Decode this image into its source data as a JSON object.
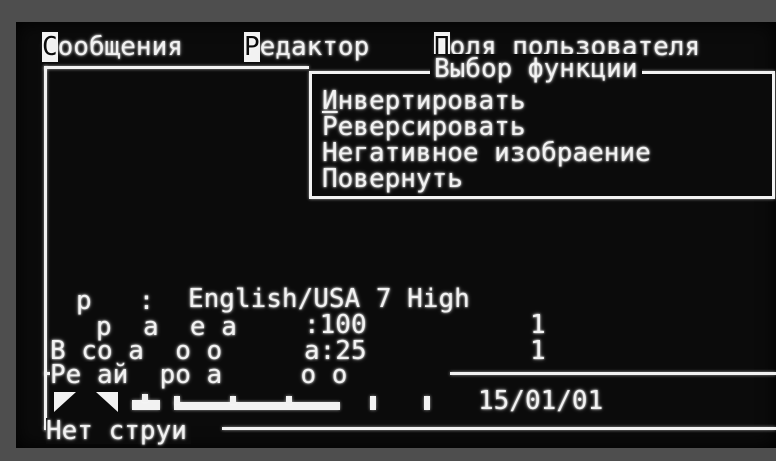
{
  "menu": {
    "items": [
      {
        "hot": "С",
        "rest": "ообщения"
      },
      {
        "hot": "Р",
        "rest": "едактор"
      },
      {
        "hot": "П",
        "rest": "оля пользователя"
      }
    ]
  },
  "popup": {
    "title": "Выбор функции",
    "items": [
      {
        "hot": "И",
        "rest": "нвертировать"
      },
      {
        "hot": "",
        "rest": "Реверсировать"
      },
      {
        "hot": "",
        "rest": "Негативное изобраение"
      },
      {
        "hot": "",
        "rest": "Повернуть"
      }
    ]
  },
  "info": {
    "row1_label": "р   :",
    "row1_value": "English/USA 7 High",
    "row2_label": "р  а  е а",
    "row2_value": ":100",
    "row2_right": "1",
    "row3_label": "В со а  о о",
    "row3_value": "а:25",
    "row3_right": "1",
    "row4_label": "Ре ай  ро а     о о"
  },
  "status": {
    "date": "15/01/01",
    "message": "Нет струи"
  }
}
